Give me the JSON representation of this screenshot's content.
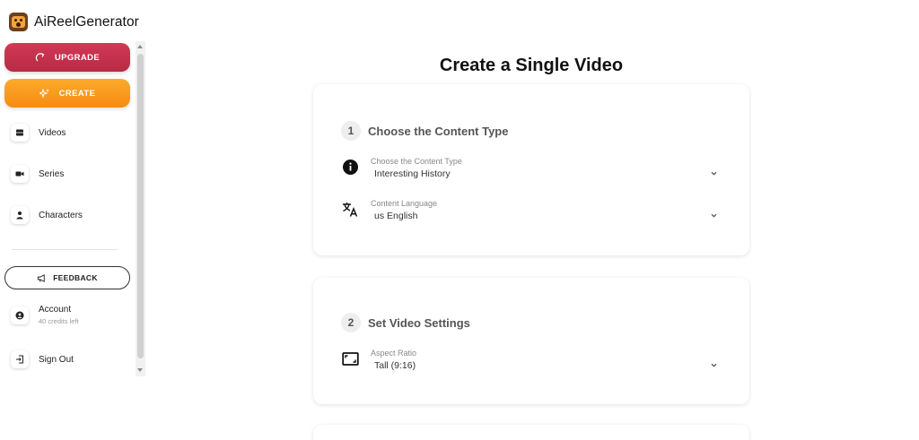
{
  "brand": {
    "name": "AiReelGenerator",
    "logo_icon": "bear-logo-icon"
  },
  "sidebar": {
    "upgrade_label": "UPGRADE",
    "create_label": "CREATE",
    "nav": [
      {
        "label": "Videos",
        "icon": "film-icon"
      },
      {
        "label": "Series",
        "icon": "camera-icon"
      },
      {
        "label": "Characters",
        "icon": "person-icon"
      }
    ],
    "feedback_label": "FEEDBACK",
    "account": {
      "label": "Account",
      "credits": "40 credits left"
    },
    "signout_label": "Sign Out"
  },
  "main": {
    "title": "Create a Single Video",
    "sections": [
      {
        "number": "1",
        "title": "Choose the Content Type",
        "fields": [
          {
            "label": "Choose the Content Type",
            "value": "Interesting History",
            "icon": "info-icon"
          },
          {
            "label": "Content Language",
            "value": "us English",
            "icon": "translate-icon"
          }
        ]
      },
      {
        "number": "2",
        "title": "Set Video Settings",
        "fields": [
          {
            "label": "Aspect Ratio",
            "value": "Tall (9:16)",
            "icon": "aspect-ratio-icon"
          }
        ]
      }
    ]
  },
  "colors": {
    "upgrade": "#c3304b",
    "create": "#f8991e",
    "text": "#222222"
  }
}
